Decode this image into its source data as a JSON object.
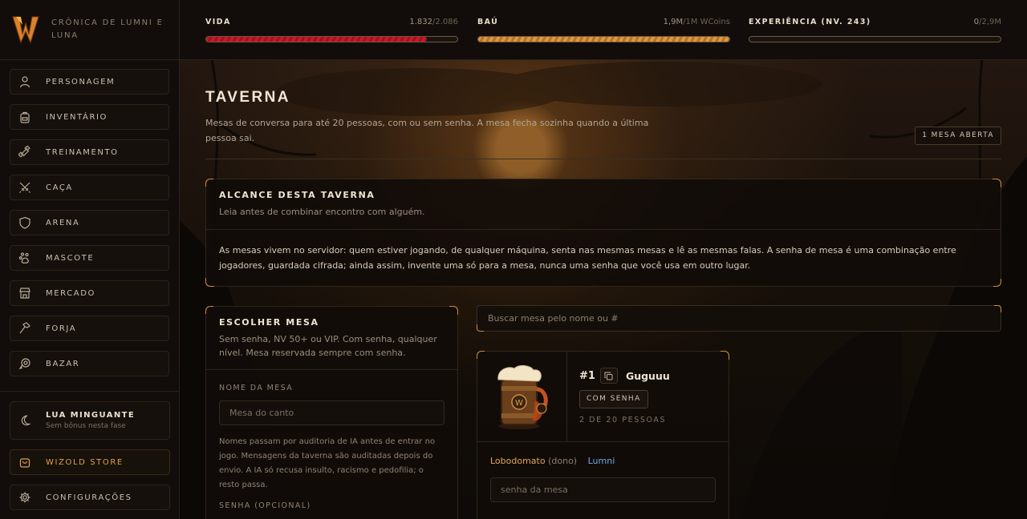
{
  "app": {
    "title": "Crônica de Lumni e Luna"
  },
  "sidebar": {
    "items": [
      {
        "label": "PERSONAGEM",
        "icon": "user-icon"
      },
      {
        "label": "INVENTÁRIO",
        "icon": "backpack-icon"
      },
      {
        "label": "TREINAMENTO",
        "icon": "dumbbell-icon"
      },
      {
        "label": "CAÇA",
        "icon": "crossed-swords-icon"
      },
      {
        "label": "ARENA",
        "icon": "shield-icon"
      },
      {
        "label": "MASCOTE",
        "icon": "paw-icon"
      },
      {
        "label": "MERCADO",
        "icon": "store-icon"
      },
      {
        "label": "FORJA",
        "icon": "hammer-icon"
      },
      {
        "label": "BAZAR",
        "icon": "coin-icon"
      }
    ],
    "moon": {
      "title": "LUA MINGUANTE",
      "subtitle": "Sem bônus nesta fase"
    },
    "store": {
      "label": "WIZOLD STORE"
    },
    "settings": {
      "label": "CONFIGURAÇÕES"
    }
  },
  "stats": {
    "life": {
      "name": "VIDA",
      "current": "1.832",
      "max": "/2.086",
      "fraction": 0.878,
      "color": "#c8172b"
    },
    "chest": {
      "name": "BAÚ",
      "current": "1,9M",
      "max": "/1M WCoins",
      "fraction": 1.0,
      "color": "#e0963a"
    },
    "xp": {
      "name": "EXPERIÊNCIA (NV. 243)",
      "current": "0",
      "max": "/2,9M",
      "fraction": 0.0
    }
  },
  "page": {
    "title": "TAVERNA",
    "description": "Mesas de conversa para até 20 pessoas, com ou sem senha. A mesa fecha sozinha quando a última pessoa sai.",
    "open_badge": "1 MESA ABERTA"
  },
  "reach": {
    "title": "ALCANCE DESTA TAVERNA",
    "subtitle": "Leia antes de combinar encontro com alguém.",
    "body": "As mesas vivem no servidor: quem estiver jogando, de qualquer máquina, senta nas mesmas mesas e lê as mesmas falas. A senha de mesa é uma combinação entre jogadores, guardada cifrada; ainda assim, invente uma só para a mesa, nunca uma senha que você usa em outro lugar."
  },
  "choose": {
    "title": "ESCOLHER MESA",
    "subtitle": "Sem senha, NV 50+ ou VIP. Com senha, qualquer nível. Mesa reservada sempre com senha.",
    "name_label": "NOME DA MESA",
    "name_placeholder": "Mesa do canto",
    "hint": "Nomes passam por auditoria de IA antes de entrar no jogo. Mensagens da taverna são auditadas depois do envio. A IA só recusa insulto, racismo e pedofilia; o resto passa.",
    "password_label": "SENHA (OPCIONAL)"
  },
  "search": {
    "placeholder": "Buscar mesa pelo nome ou #"
  },
  "tables": [
    {
      "number": "#1",
      "name": "Guguuu",
      "badge": "COM SENHA",
      "count": "2 DE 20 PESSOAS",
      "owner": "Lobodomato",
      "owner_tag": "(dono)",
      "member": "Lumni",
      "password_placeholder": "senha da mesa"
    }
  ],
  "colors": {
    "accent": "#c98c3e",
    "gold": "#e0a14a",
    "owner": "#e2a55a",
    "member": "#6fa8e0"
  }
}
